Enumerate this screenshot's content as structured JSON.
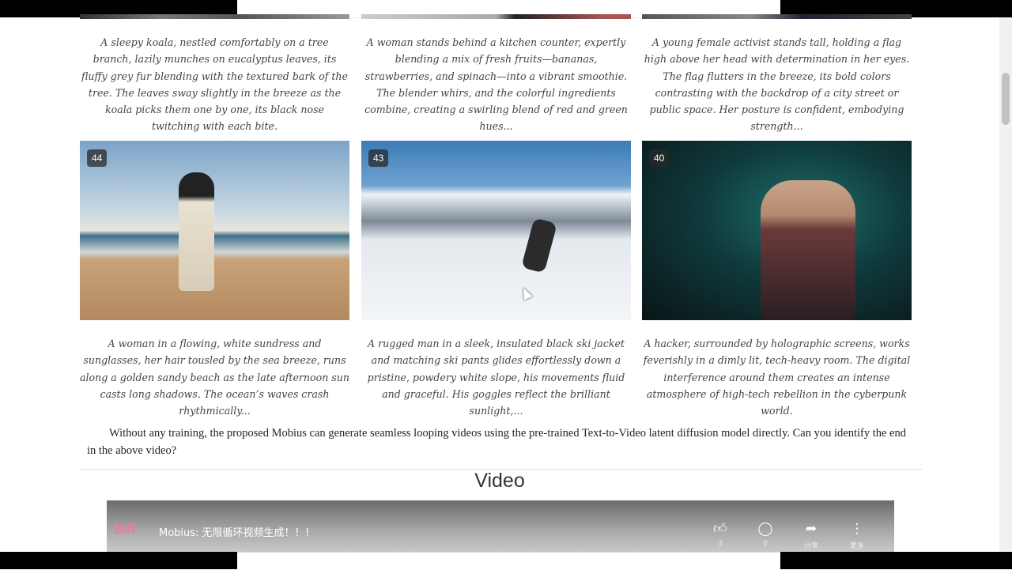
{
  "gallery_top": {
    "captions": [
      "A sleepy koala, nestled comfortably on a tree branch, lazily munches on eucalyptus leaves, its fluffy grey fur blending with the textured bark of the tree. The leaves sway slightly in the breeze as the koala picks them one by one, its black nose twitching with each bite.",
      "A woman stands behind a kitchen counter, expertly blending a mix of fresh fruits—bananas, strawberries, and spinach—into a vibrant smoothie. The blender whirs, and the colorful ingredients combine, creating a swirling blend of red and green hues...",
      "A young female activist stands tall, holding a flag high above her head with determination in her eyes. The flag flutters in the breeze, its bold colors contrasting with the backdrop of a city street or public space. Her posture is confident, embodying strength..."
    ]
  },
  "gallery": [
    {
      "badge": "44",
      "caption": "A woman in a flowing, white sundress and sunglasses, her hair tousled by the sea breeze, runs along a golden sandy beach as the late afternoon sun casts long shadows. The ocean’s waves crash rhythmically..."
    },
    {
      "badge": "43",
      "caption": "A rugged man in a sleek, insulated black ski jacket and matching ski pants glides effortlessly down a pristine, powdery white slope, his movements fluid and graceful. His goggles reflect the brilliant sunlight,..."
    },
    {
      "badge": "40",
      "caption": "A hacker, surrounded by holographic screens, works feverishly in a dimly lit, tech-heavy room. The digital interference around them creates an intense atmosphere of high-tech rebellion in the cyberpunk world."
    }
  ],
  "paragraph": "Without any training, the proposed Mobius can generate seamless looping videos using the pre-trained Text-to-Video latent diffusion model directly. Can you identify the end in the above video?",
  "section_heading": "Video",
  "video": {
    "logo": "bilibili",
    "title": "Mobius: 无限循环视频生成！！！",
    "actions": [
      {
        "icon": "thumbs-up-icon",
        "label": "3"
      },
      {
        "icon": "comment-icon",
        "label": "0"
      },
      {
        "icon": "share-icon",
        "label": "分享"
      },
      {
        "icon": "more-icon",
        "label": "更多"
      }
    ]
  }
}
